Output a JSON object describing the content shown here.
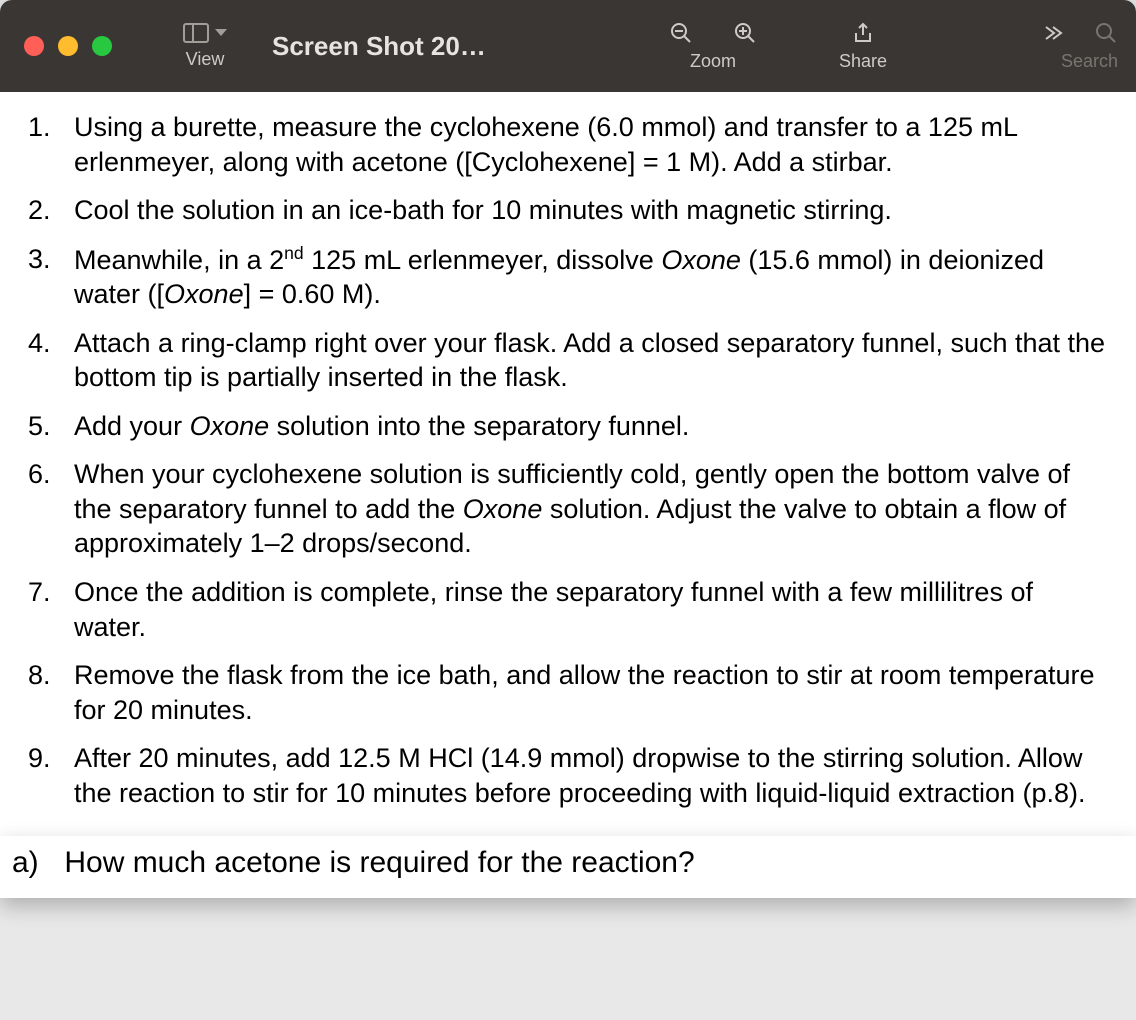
{
  "titlebar": {
    "title": "Screen Shot 20…",
    "view_label": "View",
    "zoom_label": "Zoom",
    "share_label": "Share",
    "search_label": "Search"
  },
  "steps": [
    {
      "pre": "Using a burette, measure the cyclohexene (6.0 mmol) and transfer to a 125 mL erlenmeyer, along with acetone ([Cyclohexene] = 1 M). Add a stirbar."
    },
    {
      "pre": "Cool the solution in an ice-bath for 10 minutes with magnetic stirring."
    },
    {
      "pre": "Meanwhile, in a 2",
      "sup": "nd",
      "mid": " 125 mL erlenmeyer, dissolve ",
      "ital1": "Oxone",
      "mid2": " (15.6 mmol) in deionized water ([",
      "ital2": "Oxone",
      "post": "] = 0.60 M)."
    },
    {
      "pre": "Attach a ring-clamp right over your flask. Add a closed separatory funnel, such that the bottom tip is partially inserted in the flask."
    },
    {
      "pre": "Add your ",
      "ital1": "Oxone",
      "post": " solution into the separatory funnel."
    },
    {
      "pre": "When your cyclohexene solution is sufficiently cold, gently open the bottom valve of the separatory funnel to add the ",
      "ital1": "Oxone",
      "post": " solution. Adjust the valve to obtain a flow of approximately 1–2 drops/second."
    },
    {
      "pre": "Once the addition is complete, rinse the separatory funnel with a few millilitres of water."
    },
    {
      "pre": "Remove the flask from the ice bath, and allow the reaction to stir at room temperature for 20 minutes."
    },
    {
      "pre": "After 20 minutes, add 12.5 M HCl (14.9 mmol) dropwise to the stirring solution. Allow the reaction to stir for 10 minutes before proceeding with liquid-liquid extraction (p.8)."
    }
  ],
  "question": {
    "label": "a)",
    "text": "How much acetone is required for the reaction?"
  }
}
